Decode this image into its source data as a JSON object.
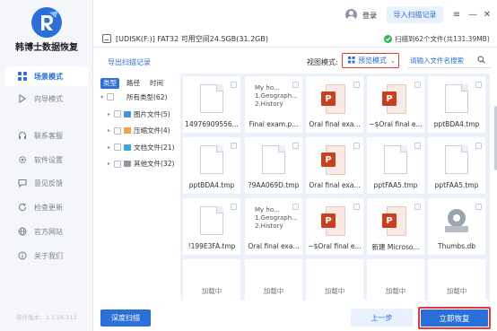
{
  "app": {
    "brand": "韩博士数据恢复",
    "version": "软件版本：1.3.26.512"
  },
  "sidebar": {
    "items": [
      {
        "label": "场景模式",
        "icon": "grid-icon",
        "active": true
      },
      {
        "label": "向导模式",
        "icon": "guide-icon",
        "active": false
      },
      {
        "label": "联系客服",
        "icon": "headset-icon",
        "active": false
      },
      {
        "label": "软件设置",
        "icon": "gear-icon",
        "active": false
      },
      {
        "label": "意见反馈",
        "icon": "feedback-icon",
        "active": false
      },
      {
        "label": "检查更新",
        "icon": "refresh-icon",
        "active": false
      },
      {
        "label": "官方网站",
        "icon": "globe-icon",
        "active": false
      },
      {
        "label": "关于我们",
        "icon": "info-icon",
        "active": false
      }
    ]
  },
  "topbar": {
    "login": "登录",
    "import_scan": "导入扫描记录"
  },
  "device": {
    "name": "[UDISK(F:)] FAT32 可用空间24.5GB(31.2GB)",
    "scan_status": "扫描到62个文件(共131.39MB)"
  },
  "toolbar": {
    "export_scan": "导出扫描记录",
    "view_label": "视图模式:",
    "view_value": "预览模式",
    "search_placeholder": "请输入文件名搜索"
  },
  "tree": {
    "tabs": [
      "类型",
      "路径",
      "时间"
    ],
    "root": "所有类型(62)",
    "children": [
      "图片文件(5)",
      "压缩文件(4)",
      "文档文件(21)",
      "其他文件(32)"
    ]
  },
  "files": [
    {
      "name": "14976909556...",
      "kind": "doc"
    },
    {
      "name": "Final exam.p...",
      "kind": "text",
      "preview": [
        "My ho...",
        "1.Geograph...",
        "2.History"
      ]
    },
    {
      "name": "Oral final exa...",
      "kind": "ppt"
    },
    {
      "name": "~$Oral final e...",
      "kind": "ppt"
    },
    {
      "name": "pptBDA4.tmp",
      "kind": "doc"
    },
    {
      "name": "pptBDA4.tmp",
      "kind": "doc"
    },
    {
      "name": "?9AA069D.tmp",
      "kind": "doc"
    },
    {
      "name": "Oral final exa...",
      "kind": "ppt"
    },
    {
      "name": "pptFAA5.tmp",
      "kind": "doc"
    },
    {
      "name": "pptFAA5.tmp",
      "kind": "doc"
    },
    {
      "name": "!199E3FA.tmp",
      "kind": "doc"
    },
    {
      "name": "Oral final exa...",
      "kind": "text",
      "preview": [
        "My ho...",
        "1.Geograph...",
        "2.History"
      ]
    },
    {
      "name": "~$Oral final e...",
      "kind": "ppt"
    },
    {
      "name": "新建 Microso...",
      "kind": "ppt"
    },
    {
      "name": "Thumbs.db",
      "kind": "db"
    },
    {
      "name": "加载中",
      "kind": "loading"
    },
    {
      "name": "加载中",
      "kind": "loading"
    },
    {
      "name": "加载中",
      "kind": "loading"
    },
    {
      "name": "加载中",
      "kind": "loading"
    },
    {
      "name": "加载中",
      "kind": "loading"
    }
  ],
  "buttons": {
    "deep_scan": "深度扫描",
    "previous": "上一步",
    "recover": "立即恢复"
  },
  "colors": {
    "accent": "#2b6fd8",
    "highlight_border": "#e53935",
    "ppt": "#c8401f",
    "grid_bg": "#eaf1fb"
  }
}
